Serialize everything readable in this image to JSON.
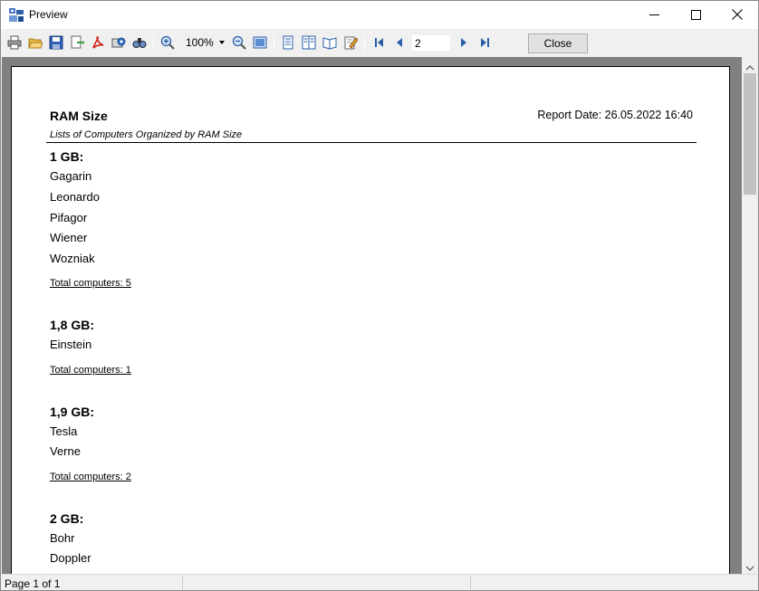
{
  "window": {
    "title": "Preview"
  },
  "toolbar": {
    "zoom_value": "100%",
    "page_number": "2",
    "close_label": "Close",
    "icons": [
      "print-icon",
      "open-icon",
      "save-icon",
      "export-icon",
      "pdf-icon",
      "email-icon",
      "find-icon",
      "zoom-in-icon",
      "zoom-out-icon",
      "page-width-icon",
      "one-page-icon",
      "two-pages-icon",
      "book-icon",
      "edit-icon",
      "first-page-icon",
      "previous-page-icon",
      "next-page-icon",
      "last-page-icon"
    ]
  },
  "report": {
    "title": "RAM Size",
    "subtitle": "Lists of Computers Organized by RAM Size",
    "date": "Report Date: 26.05.2022 16:40",
    "groups": [
      {
        "title": "1 GB:",
        "items": [
          "Gagarin",
          "Leonardo",
          "Pifagor",
          "Wiener",
          "Wozniak"
        ],
        "total": "Total computers: 5"
      },
      {
        "title": "1,8 GB:",
        "items": [
          "Einstein"
        ],
        "total": "Total computers: 1"
      },
      {
        "title": "1,9 GB:",
        "items": [
          "Tesla",
          "Verne"
        ],
        "total": "Total computers: 2"
      },
      {
        "title": "2 GB:",
        "items": [
          "Bohr",
          "Doppler"
        ]
      }
    ]
  },
  "status": {
    "page_info": "Page 1 of 1"
  }
}
